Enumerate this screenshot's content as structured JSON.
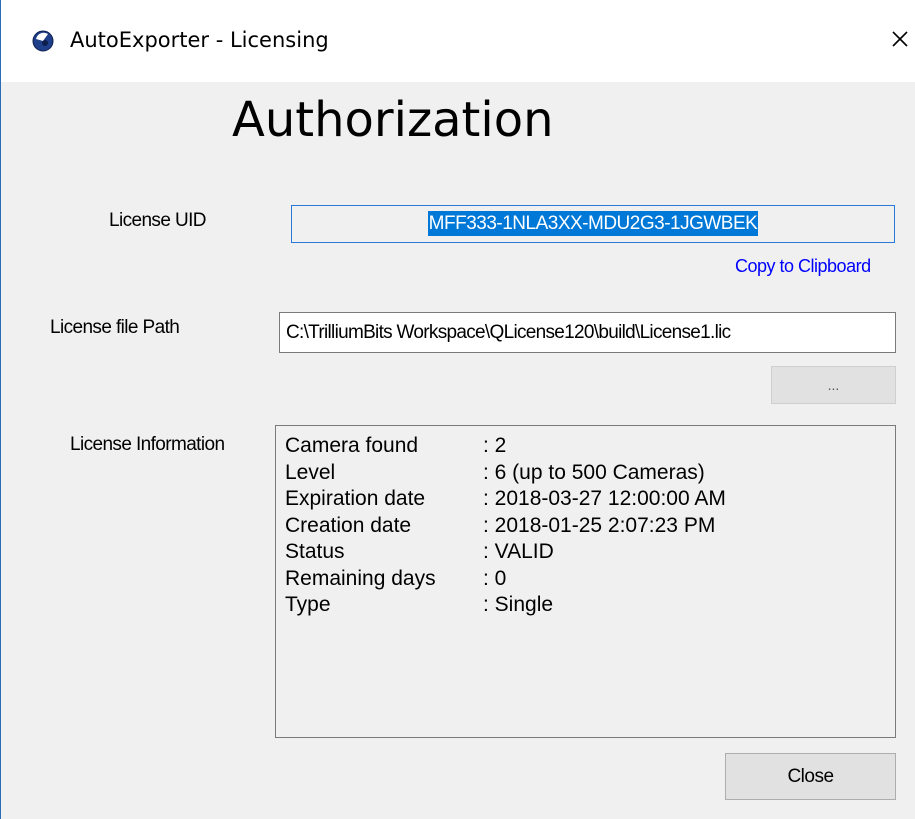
{
  "window": {
    "title": "AutoExporter - Licensing",
    "accent_color": "#0078d7"
  },
  "heading": "Authorization",
  "license_uid": {
    "label": "License UID",
    "value": "MFF333-1NLA3XX-MDU2G3-1JGWBEK",
    "copy_link": "Copy to Clipboard"
  },
  "license_file": {
    "label": "License file Path",
    "value": "C:\\TrilliumBits Workspace\\QLicense120\\build\\License1.lic",
    "browse_label": "..."
  },
  "license_info": {
    "label": "License Information",
    "rows": [
      {
        "key": "Camera found",
        "value": ": 2"
      },
      {
        "key": "Level",
        "value": ": 6 (up to 500 Cameras)"
      },
      {
        "key": "Expiration date",
        "value": ": 2018-03-27 12:00:00 AM"
      },
      {
        "key": "Creation date",
        "value": ": 2018-01-25 2:07:23 PM"
      },
      {
        "key": "Status",
        "value": ": VALID"
      },
      {
        "key": "Remaining days",
        "value": ": 0"
      },
      {
        "key": "Type",
        "value": ": Single"
      }
    ]
  },
  "buttons": {
    "close": "Close"
  }
}
